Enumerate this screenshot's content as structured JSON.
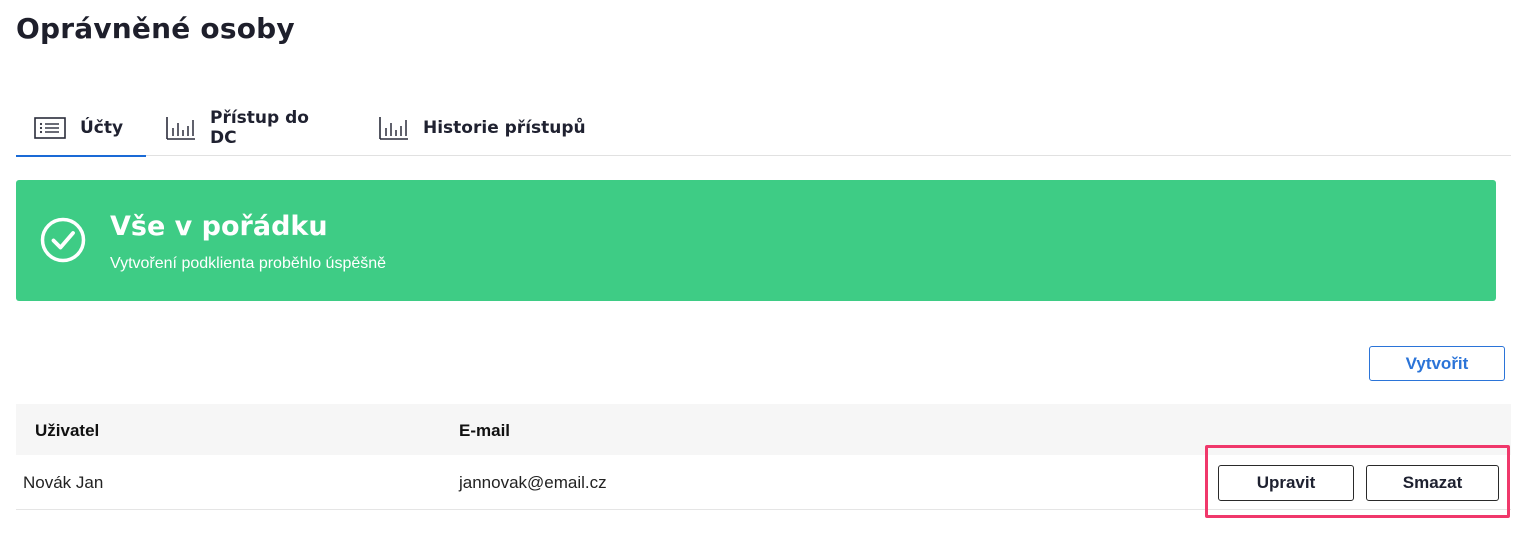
{
  "page": {
    "title": "Oprávněné osoby"
  },
  "tabs": [
    {
      "label": "Účty",
      "icon": "list-icon",
      "active": true
    },
    {
      "label": "Přístup do DC",
      "icon": "bar-chart-icon",
      "active": false
    },
    {
      "label": "Historie přístupů",
      "icon": "bar-chart-icon",
      "active": false
    }
  ],
  "alert": {
    "title": "Vše v pořádku",
    "message": "Vytvoření podklienta proběhlo úspěšně",
    "icon": "check-circle-icon",
    "color": "#3ecc85"
  },
  "actions": {
    "create_label": "Vytvořit"
  },
  "table": {
    "headers": {
      "user": "Uživatel",
      "email": "E-mail"
    },
    "rows": [
      {
        "user": "Novák Jan",
        "email": "jannovak@email.cz",
        "edit_label": "Upravit",
        "delete_label": "Smazat"
      }
    ]
  },
  "colors": {
    "accent": "#2b74d8",
    "success": "#3ecc85",
    "highlight": "#f0386b"
  }
}
